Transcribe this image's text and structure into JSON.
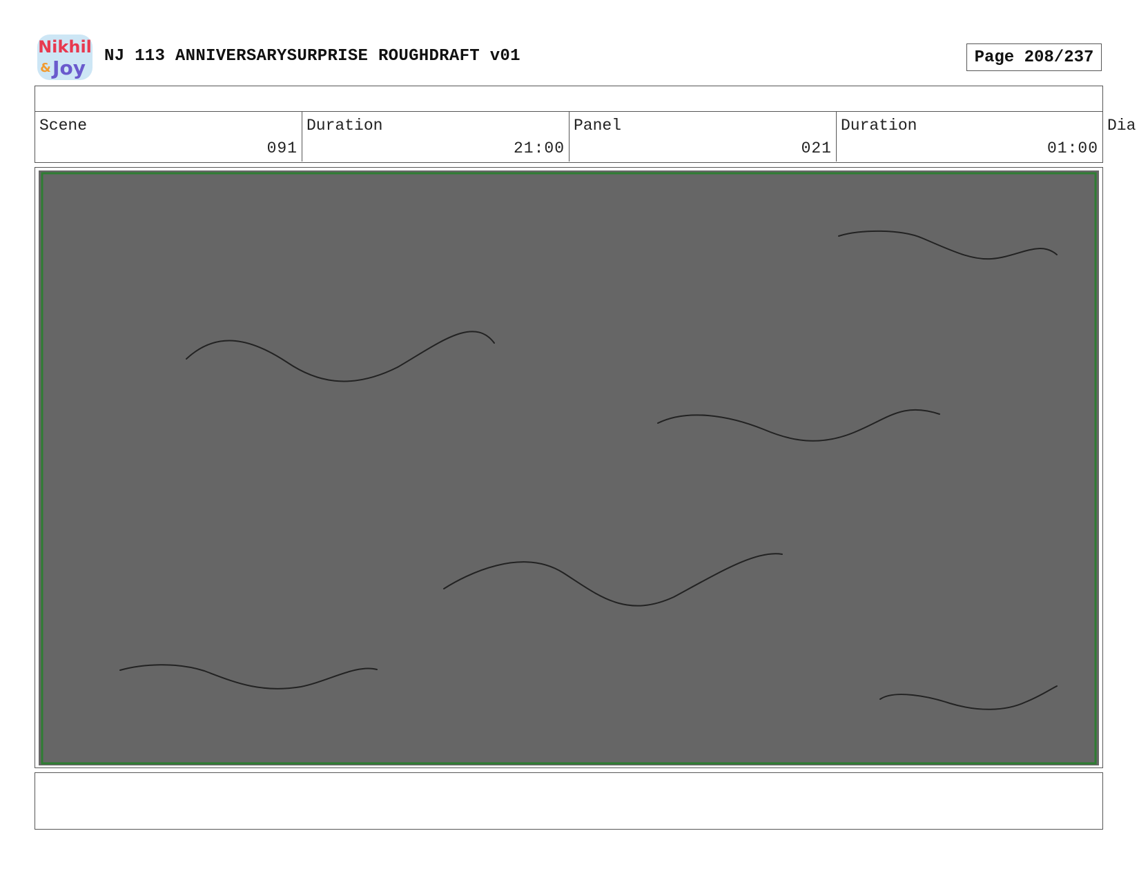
{
  "header": {
    "logo": {
      "line1": "Nikhil",
      "line2": "&",
      "line3": "Joy"
    },
    "title": "NJ 113 ANNIVERSARYSURPRISE ROUGHDRAFT v01",
    "page_label": "Page 208/237"
  },
  "info": {
    "scene_label": "Scene",
    "scene_value": "091",
    "scene_duration_label": "Duration",
    "scene_duration_value": "21:00",
    "panel_label": "Panel",
    "panel_value": "021",
    "panel_duration_label": "Duration",
    "panel_duration_value": "01:00",
    "dialogue_label_partial": "Dia"
  },
  "panel": {
    "background_color": "#666666",
    "safe_frame_color": "#2e7d32",
    "stroke_color": "#222222",
    "content": "wavy sketch lines"
  },
  "colors": {
    "border": "#555555",
    "logo_red": "#e8394f",
    "logo_orange": "#f29a2e",
    "logo_purple": "#6a5acd",
    "logo_outline": "#cde6f5"
  }
}
